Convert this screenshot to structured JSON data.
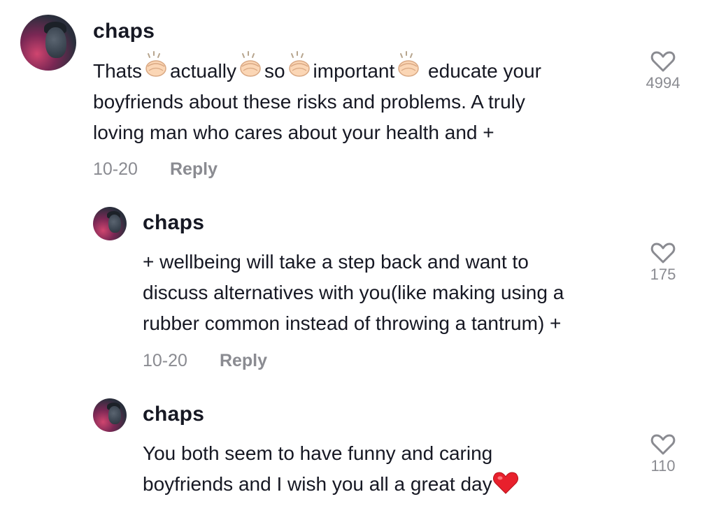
{
  "comments": [
    {
      "username": "chaps",
      "text_lines": {
        "l1_parts": [
          "Thats",
          "actually",
          "so",
          "important",
          " educate your"
        ],
        "l2": "boyfriends about these risks and problems. A truly",
        "l3": "loving man who cares about your health and +"
      },
      "date": "10-20",
      "reply_label": "Reply",
      "likes": "4994",
      "emoji": "clapping-hands"
    },
    {
      "username": "chaps",
      "text_lines": {
        "l1": "+ wellbeing will take a step back and want to",
        "l2": "discuss alternatives with you(like making using a",
        "l3": "rubber common instead of throwing a tantrum) +"
      },
      "date": "10-20",
      "reply_label": "Reply",
      "likes": "175"
    },
    {
      "username": "chaps",
      "text_lines": {
        "l1": "You both seem to have funny and caring",
        "l2": "boyfriends and I wish you all a great day"
      },
      "likes": "110",
      "emoji": "red-heart"
    }
  ],
  "colors": {
    "text": "#161823",
    "muted": "#8a8b91",
    "heart_outline": "#8a8b91",
    "emoji_heart": "#e8202c"
  }
}
